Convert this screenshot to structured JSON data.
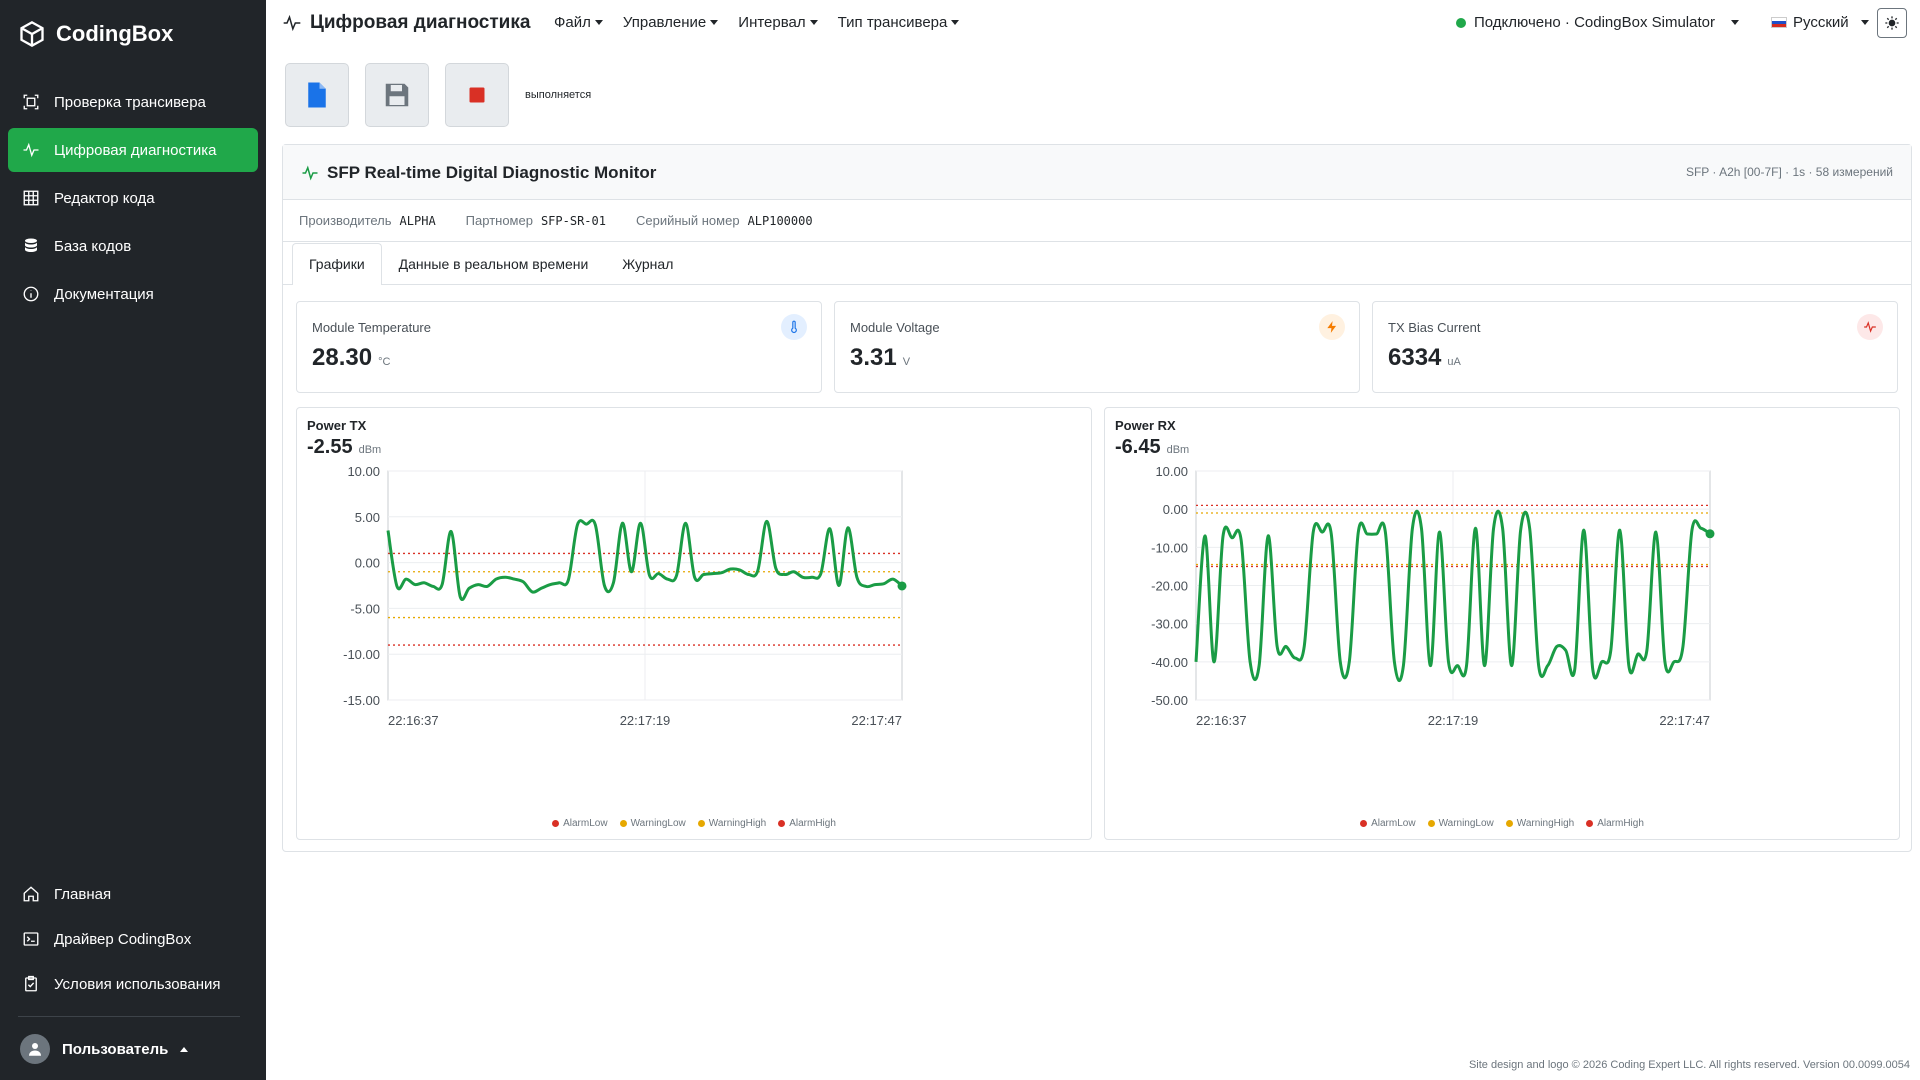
{
  "brand": {
    "name": "CodingBox"
  },
  "sidebar": {
    "items": [
      {
        "label": "Проверка трансивера",
        "icon": "scan-icon"
      },
      {
        "label": "Цифровая диагностика",
        "icon": "pulse-icon",
        "active": true
      },
      {
        "label": "Редактор кода",
        "icon": "grid-icon"
      },
      {
        "label": "База кодов",
        "icon": "database-icon"
      },
      {
        "label": "Документация",
        "icon": "info-icon"
      }
    ],
    "bottom_items": [
      {
        "label": "Главная",
        "icon": "home-icon"
      },
      {
        "label": "Драйвер CodingBox",
        "icon": "terminal-icon"
      },
      {
        "label": "Условия использования",
        "icon": "clipboard-check-icon"
      }
    ],
    "user": {
      "label": "Пользователь"
    }
  },
  "header": {
    "title": "Цифровая диагностика",
    "menu": [
      "Файл",
      "Управление",
      "Интервал",
      "Тип трансивера"
    ],
    "connection": "Подключено · CodingBox Simulator",
    "language": "Русский"
  },
  "toolbar": {
    "status": "выполняется",
    "colors": {
      "new": "#1a73e8",
      "save": "#6c757d",
      "stop": "#d93025"
    }
  },
  "monitor": {
    "title": "SFP Real-time Digital Diagnostic Monitor",
    "meta": "SFP · A2h [00-7F] · 1s · 58 измерений",
    "info": [
      {
        "label": "Производитель",
        "value": "ALPHA"
      },
      {
        "label": "Партномер",
        "value": "SFP-SR-01"
      },
      {
        "label": "Серийный номер",
        "value": "ALP100000"
      }
    ],
    "tabs": [
      "Графики",
      "Данные в реальном времени",
      "Журнал"
    ],
    "active_tab": 0
  },
  "metrics": [
    {
      "label": "Module Temperature",
      "value": "28.30",
      "unit": "°C",
      "icon": "thermometer-icon",
      "color": "#1a73e8",
      "bg": "#e3efff"
    },
    {
      "label": "Module Voltage",
      "value": "3.31",
      "unit": "V",
      "icon": "lightning-icon",
      "color": "#f57c00",
      "bg": "#fff1e0"
    },
    {
      "label": "TX Bias Current",
      "value": "6334",
      "unit": "uA",
      "icon": "pulse-icon",
      "color": "#d93025",
      "bg": "#fde8e8"
    }
  ],
  "legend": [
    {
      "label": "AlarmLow",
      "color": "#d93025"
    },
    {
      "label": "WarningLow",
      "color": "#e6a800"
    },
    {
      "label": "WarningHigh",
      "color": "#e6a800"
    },
    {
      "label": "AlarmHigh",
      "color": "#d93025"
    }
  ],
  "chart_data": [
    {
      "type": "line",
      "title": "Power TX",
      "current": "-2.55",
      "unit": "dBm",
      "ylim": [
        -15,
        10
      ],
      "yticks": [
        "10.00",
        "5.00",
        "0.00",
        "-5.00",
        "-10.00",
        "-15.00"
      ],
      "xticks": [
        "22:16:37",
        "22:17:19",
        "22:17:47"
      ],
      "thresholds": {
        "AlarmLow": -9,
        "WarningLow": -6,
        "WarningHigh": -1,
        "AlarmHigh": 1
      },
      "color": "#1a9c45",
      "values": [
        3.5,
        -2.6,
        -1.8,
        -2.4,
        -2.2,
        -2.6,
        -2.4,
        3.4,
        -3.7,
        -2.8,
        -2.4,
        -2.6,
        -1.8,
        -1.6,
        -1.8,
        -2.1,
        -3.2,
        -2.8,
        -2.4,
        -2.2,
        -1.9,
        4.1,
        4.2,
        4.1,
        -2.5,
        -2.2,
        4.3,
        -1.0,
        4.3,
        -1.4,
        -1.2,
        -1.8,
        -1.4,
        4.3,
        -1.6,
        -1.3,
        -1.2,
        -1.1,
        -0.7,
        -0.8,
        -1.3,
        -0.9,
        4.5,
        -0.6,
        -1.3,
        -1.0,
        -1.6,
        -1.6,
        -1.2,
        3.7,
        -2.5,
        3.8,
        -1.6,
        -2.6,
        -2.4,
        -2.3,
        -1.8,
        -2.55
      ]
    },
    {
      "type": "line",
      "title": "Power RX",
      "current": "-6.45",
      "unit": "dBm",
      "ylim": [
        -50,
        10
      ],
      "yticks": [
        "10.00",
        "0.00",
        "-10.00",
        "-20.00",
        "-30.00",
        "-40.00",
        "-50.00"
      ],
      "xticks": [
        "22:16:37",
        "22:17:19",
        "22:17:47"
      ],
      "thresholds": {
        "AlarmLow": -15,
        "WarningLow": -14.5,
        "WarningHigh": -1,
        "AlarmHigh": 1
      },
      "color": "#1a9c45",
      "values": [
        -40,
        -7,
        -40,
        -7,
        -7.5,
        -8,
        -40,
        -41,
        -7,
        -36,
        -36,
        -39,
        -36,
        -6,
        -6,
        -6.5,
        -40,
        -40,
        -6,
        -6.5,
        -6.5,
        -6,
        -40,
        -41,
        -5,
        -5,
        -41,
        -6,
        -40,
        -41,
        -41,
        -5,
        -41,
        -5,
        -5,
        -41,
        -5.5,
        -5,
        -41,
        -41,
        -36,
        -37,
        -42,
        -5.5,
        -42,
        -40,
        -37,
        -5.5,
        -41,
        -38,
        -37,
        -6,
        -40,
        -40,
        -36,
        -5.5,
        -5,
        -6.45
      ]
    }
  ],
  "footer": "Site design and logo © 2026 Coding Expert LLC. All rights reserved. Version 00.0099.0054"
}
